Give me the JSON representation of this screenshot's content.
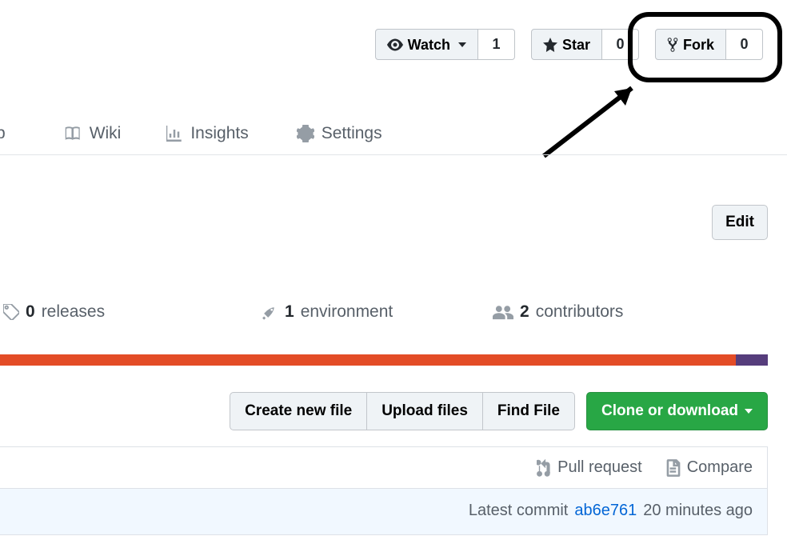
{
  "top_buttons": {
    "watch": {
      "label": "Watch",
      "count": "1"
    },
    "star": {
      "label": "Star",
      "count": "0"
    },
    "fork": {
      "label": "Fork",
      "count": "0"
    }
  },
  "tabs": {
    "partial": "b",
    "wiki": "Wiki",
    "insights": "Insights",
    "settings": "Settings"
  },
  "edit_label": "Edit",
  "stats": {
    "releases": {
      "count": "0",
      "label": "releases"
    },
    "environment": {
      "count": "1",
      "label": "environment"
    },
    "contributors": {
      "count": "2",
      "label": "contributors"
    }
  },
  "lang_colors": {
    "primary": "#e34c26",
    "secondary": "#563d7c"
  },
  "file_actions": {
    "create": "Create new file",
    "upload": "Upload files",
    "find": "Find File",
    "clone": "Clone or download"
  },
  "bottom": {
    "pull_request": "Pull request",
    "compare": "Compare",
    "latest_commit_label": "Latest commit",
    "sha": "ab6e761",
    "time": "20 minutes ago"
  }
}
